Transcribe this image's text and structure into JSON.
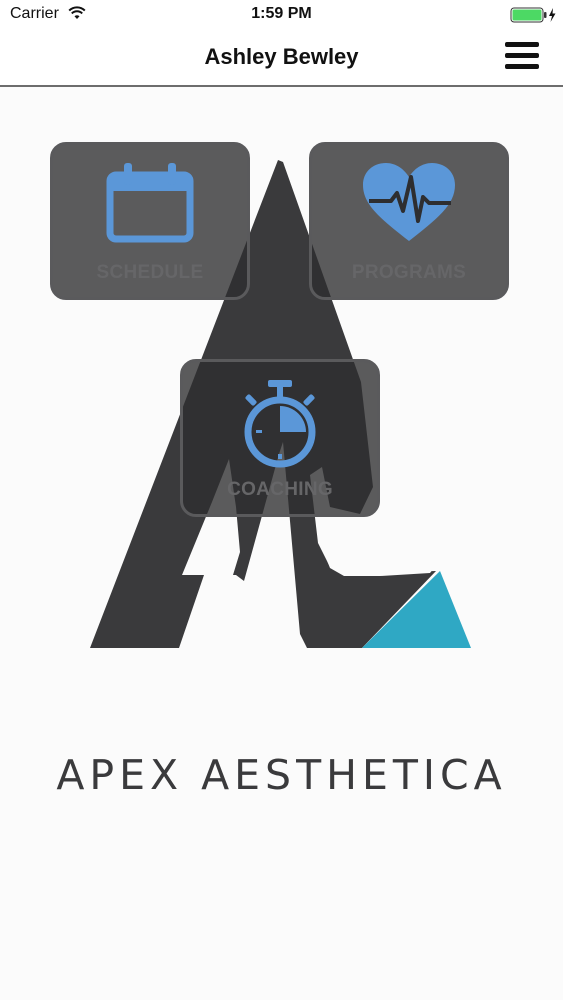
{
  "status_bar": {
    "carrier": "Carrier",
    "time": "1:59 PM",
    "wifi_icon": "wifi-icon",
    "battery_icon": "battery-charging-icon",
    "battery_color": "#4cd964"
  },
  "nav": {
    "title": "Ashley Bewley",
    "menu_icon": "hamburger-menu-icon"
  },
  "tiles": [
    {
      "label": "SCHEDULE",
      "icon": "calendar-icon"
    },
    {
      "label": "PROGRAMS",
      "icon": "heart-rate-icon"
    },
    {
      "label": "COACHING",
      "icon": "stopwatch-icon"
    }
  ],
  "brand": {
    "name": "APEX AESTHETICA",
    "logo_color": "#3a3a3c",
    "accent_color": "#2fa8c4",
    "icon_color": "#5b97d8"
  }
}
